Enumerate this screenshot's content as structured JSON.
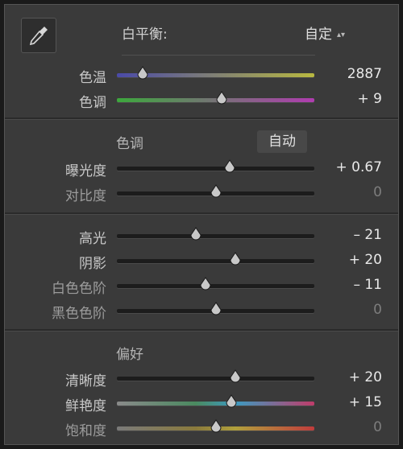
{
  "white_balance": {
    "label": "白平衡:",
    "selected": "自定"
  },
  "tone_section": {
    "title": "色调",
    "auto_label": "自动"
  },
  "presence_section": {
    "title": "偏好"
  },
  "rows": {
    "temp": {
      "label": "色温",
      "value": "2887",
      "level": 0.13
    },
    "tint": {
      "label": "色调",
      "value": "+ 9",
      "level": 0.53
    },
    "exposure": {
      "label": "曝光度",
      "value": "+ 0.67",
      "level": 0.57
    },
    "contrast": {
      "label": "对比度",
      "value": "0",
      "level": 0.5
    },
    "highlights": {
      "label": "高光",
      "value": "– 21",
      "level": 0.4
    },
    "shadows": {
      "label": "阴影",
      "value": "+ 20",
      "level": 0.6
    },
    "whites": {
      "label": "白色色阶",
      "value": "– 11",
      "level": 0.45
    },
    "blacks": {
      "label": "黑色色阶",
      "value": "0",
      "level": 0.5
    },
    "clarity": {
      "label": "清晰度",
      "value": "+ 20",
      "level": 0.6
    },
    "vibrance": {
      "label": "鲜艳度",
      "value": "+ 15",
      "level": 0.58
    },
    "saturation": {
      "label": "饱和度",
      "value": "0",
      "level": 0.5
    }
  },
  "colors": {
    "panel_bg": "#3a3a3a",
    "temp_gradient": [
      "#4a4aa8",
      "#b8b840"
    ],
    "tint_gradient": [
      "#3ca83c",
      "#b03cb0"
    ],
    "vibrance_gradient": [
      "#8a8a8a",
      "#3c9ac0",
      "#c03c6a"
    ],
    "saturation_gradient": [
      "#8a8a8a",
      "#c0a03c",
      "#c03c3c"
    ]
  }
}
